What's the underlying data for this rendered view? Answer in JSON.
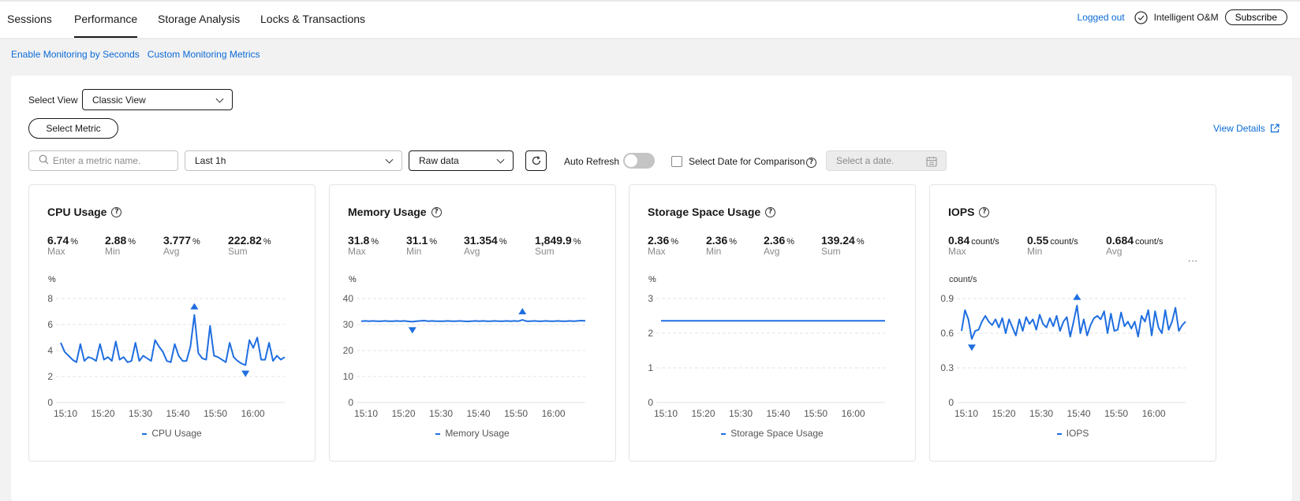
{
  "tabs": [
    {
      "label": "Sessions"
    },
    {
      "label": "Performance",
      "active": true
    },
    {
      "label": "Storage Analysis"
    },
    {
      "label": "Locks & Transactions"
    }
  ],
  "header": {
    "logged_out": "Logged out",
    "intelligent_om": "Intelligent O&M",
    "subscribe": "Subscribe"
  },
  "links": {
    "enable_monitoring": "Enable Monitoring by Seconds",
    "custom_metrics": "Custom Monitoring Metrics"
  },
  "toolbar": {
    "select_view_label": "Select View",
    "view_value": "Classic View",
    "select_metric": "Select Metric",
    "view_details": "View Details",
    "search_placeholder": "Enter a metric name.",
    "range_value": "Last 1h",
    "data_value": "Raw data",
    "auto_refresh": "Auto Refresh",
    "auto_refresh_on": false,
    "compare_label": "Select Date for Comparison",
    "date_placeholder": "Select a date."
  },
  "colors": {
    "series": "#1f6ee0",
    "link": "#0a6ad6"
  },
  "cards": [
    {
      "title": "CPU Usage",
      "stats": [
        {
          "value": "6.74",
          "unit": "%",
          "key": "Max"
        },
        {
          "value": "2.88",
          "unit": "%",
          "key": "Min"
        },
        {
          "value": "3.777",
          "unit": "%",
          "key": "Avg"
        },
        {
          "value": "222.82",
          "unit": "%",
          "key": "Sum"
        }
      ],
      "legend": "CPU Usage"
    },
    {
      "title": "Memory Usage",
      "stats": [
        {
          "value": "31.8",
          "unit": "%",
          "key": "Max"
        },
        {
          "value": "31.1",
          "unit": "%",
          "key": "Min"
        },
        {
          "value": "31.354",
          "unit": "%",
          "key": "Avg"
        },
        {
          "value": "1,849.9",
          "unit": "%",
          "key": "Sum"
        }
      ],
      "legend": "Memory Usage"
    },
    {
      "title": "Storage Space Usage",
      "stats": [
        {
          "value": "2.36",
          "unit": "%",
          "key": "Max"
        },
        {
          "value": "2.36",
          "unit": "%",
          "key": "Min"
        },
        {
          "value": "2.36",
          "unit": "%",
          "key": "Avg"
        },
        {
          "value": "139.24",
          "unit": "%",
          "key": "Sum"
        }
      ],
      "legend": "Storage Space Usage"
    },
    {
      "title": "IOPS",
      "stats": [
        {
          "value": "0.84",
          "unit": "count/s",
          "key": "Max"
        },
        {
          "value": "0.55",
          "unit": "count/s",
          "key": "Min"
        },
        {
          "value": "0.684",
          "unit": "count/s",
          "key": "Avg"
        }
      ],
      "more": "...",
      "legend": "IOPS"
    }
  ],
  "chart_data": [
    {
      "type": "line",
      "title": "CPU Usage",
      "ylabel": "%",
      "ylim": [
        0,
        8
      ],
      "yticks": [
        "0",
        "2",
        "4",
        "6",
        "8"
      ],
      "xticks": [
        "15:10",
        "15:20",
        "15:30",
        "15:40",
        "15:50",
        "16:00"
      ],
      "grid": true,
      "series": [
        {
          "name": "CPU Usage",
          "values": [
            4.6,
            3.9,
            3.6,
            3.3,
            3.1,
            4.5,
            3.2,
            3.5,
            3.4,
            3.2,
            4.5,
            3.3,
            3.5,
            3.2,
            4.7,
            3.3,
            3.5,
            3.1,
            3.2,
            4.6,
            3.2,
            3.6,
            3.4,
            3.2,
            4.8,
            4.3,
            3.9,
            3.2,
            3.1,
            4.5,
            3.6,
            3.2,
            3.2,
            4.3,
            6.74,
            3.8,
            3.4,
            3.3,
            5.9,
            3.6,
            3.5,
            3.3,
            3.1,
            4.6,
            3.5,
            3.2,
            3.0,
            2.88,
            4.8,
            4.2,
            5.0,
            3.3,
            3.3,
            4.6,
            3.2,
            3.6,
            3.3,
            3.5
          ]
        }
      ],
      "markers": [
        {
          "type": "max",
          "value": 6.74
        },
        {
          "type": "min",
          "value": 2.88
        }
      ]
    },
    {
      "type": "line",
      "title": "Memory Usage",
      "ylabel": "%",
      "ylim": [
        0,
        40
      ],
      "yticks": [
        "0",
        "10",
        "20",
        "30",
        "40"
      ],
      "xticks": [
        "15:10",
        "15:20",
        "15:30",
        "15:40",
        "15:50",
        "16:00"
      ],
      "grid": true,
      "series": [
        {
          "name": "Memory Usage",
          "values": [
            31.3,
            31.4,
            31.3,
            31.4,
            31.3,
            31.3,
            31.4,
            31.3,
            31.3,
            31.4,
            31.3,
            31.4,
            31.2,
            31.1,
            31.3,
            31.4,
            31.5,
            31.3,
            31.4,
            31.3,
            31.3,
            31.3,
            31.4,
            31.3,
            31.3,
            31.4,
            31.3,
            31.2,
            31.3,
            31.4,
            31.3,
            31.4,
            31.3,
            31.3,
            31.4,
            31.3,
            31.3,
            31.4,
            31.3,
            31.4,
            31.3,
            31.8,
            31.3,
            31.3,
            31.4,
            31.3,
            31.3,
            31.4,
            31.3,
            31.3,
            31.4,
            31.3,
            31.3,
            31.4,
            31.3,
            31.4,
            31.5,
            31.4
          ]
        }
      ],
      "markers": [
        {
          "type": "max",
          "value": 31.8
        },
        {
          "type": "min",
          "value": 31.1
        }
      ]
    },
    {
      "type": "line",
      "title": "Storage Space Usage",
      "ylabel": "%",
      "ylim": [
        0,
        3
      ],
      "yticks": [
        "0",
        "1",
        "2",
        "3"
      ],
      "xticks": [
        "15:10",
        "15:20",
        "15:30",
        "15:40",
        "15:50",
        "16:00"
      ],
      "grid": true,
      "series": [
        {
          "name": "Storage Space Usage",
          "values": [
            2.36,
            2.36,
            2.36,
            2.36,
            2.36,
            2.36,
            2.36,
            2.36,
            2.36,
            2.36,
            2.36,
            2.36,
            2.36,
            2.36,
            2.36,
            2.36,
            2.36,
            2.36,
            2.36,
            2.36,
            2.36,
            2.36,
            2.36,
            2.36,
            2.36,
            2.36,
            2.36,
            2.36,
            2.36,
            2.36,
            2.36,
            2.36,
            2.36,
            2.36,
            2.36,
            2.36,
            2.36,
            2.36,
            2.36,
            2.36,
            2.36,
            2.36,
            2.36,
            2.36,
            2.36,
            2.36,
            2.36,
            2.36,
            2.36,
            2.36,
            2.36,
            2.36,
            2.36,
            2.36,
            2.36,
            2.36,
            2.36,
            2.36,
            2.36
          ]
        }
      ],
      "markers": []
    },
    {
      "type": "line",
      "title": "IOPS",
      "ylabel": "count/s",
      "ylim": [
        0,
        0.9
      ],
      "yticks": [
        "0",
        "0.3",
        "0.6",
        "0.9"
      ],
      "xticks": [
        "15:10",
        "15:20",
        "15:30",
        "15:40",
        "15:50",
        "16:00"
      ],
      "grid": true,
      "series": [
        {
          "name": "IOPS",
          "values": [
            0.62,
            0.8,
            0.72,
            0.55,
            0.62,
            0.63,
            0.7,
            0.75,
            0.7,
            0.67,
            0.72,
            0.65,
            0.73,
            0.6,
            0.72,
            0.65,
            0.58,
            0.72,
            0.62,
            0.74,
            0.68,
            0.72,
            0.63,
            0.76,
            0.68,
            0.65,
            0.73,
            0.66,
            0.75,
            0.62,
            0.7,
            0.74,
            0.57,
            0.7,
            0.84,
            0.6,
            0.72,
            0.58,
            0.67,
            0.73,
            0.75,
            0.72,
            0.79,
            0.6,
            0.77,
            0.62,
            0.63,
            0.78,
            0.66,
            0.7,
            0.64,
            0.7,
            0.57,
            0.75,
            0.7,
            0.8,
            0.58,
            0.79,
            0.65,
            0.6,
            0.8,
            0.63,
            0.7,
            0.82,
            0.62,
            0.67,
            0.7
          ]
        }
      ],
      "markers": [
        {
          "type": "max",
          "value": 0.84
        },
        {
          "type": "min",
          "value": 0.55
        }
      ]
    }
  ]
}
